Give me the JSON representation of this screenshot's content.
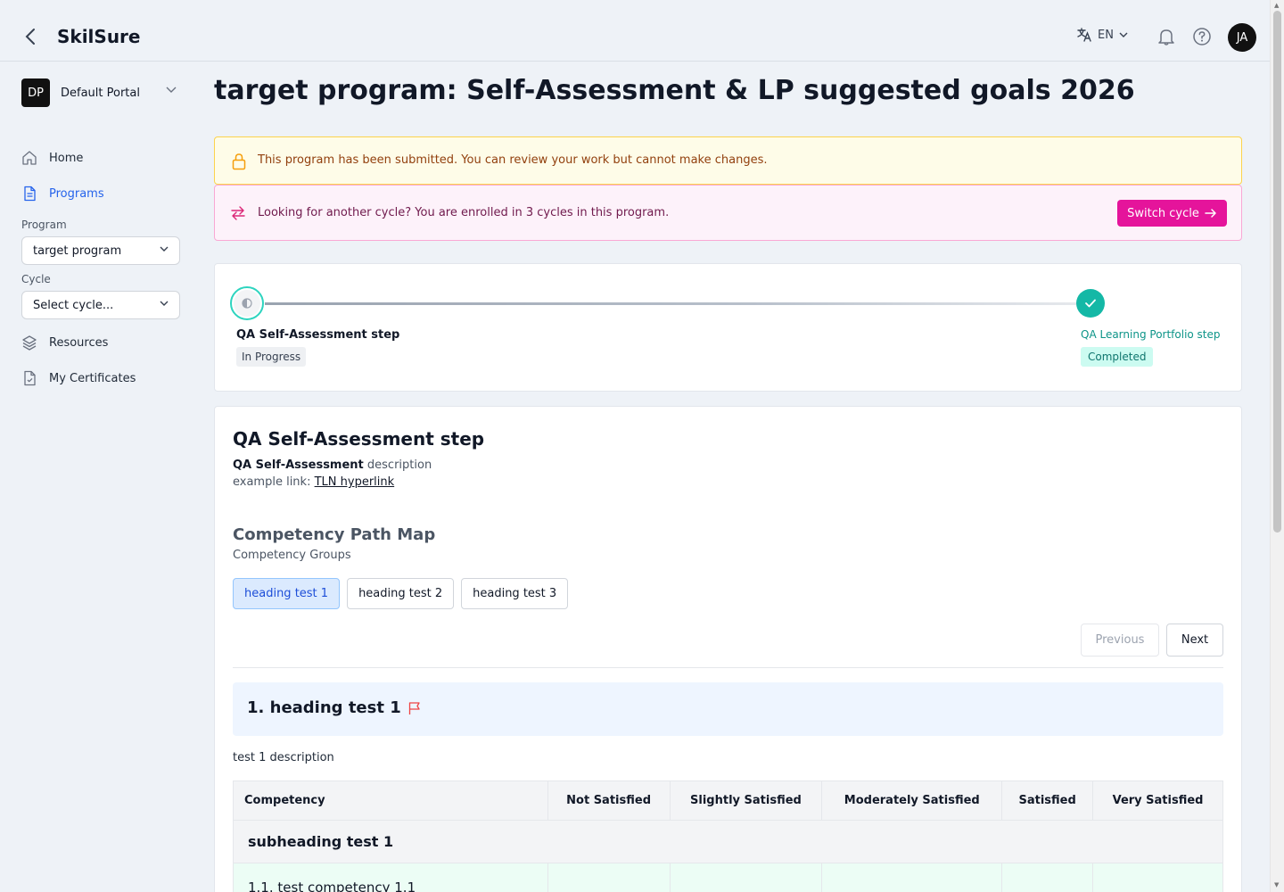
{
  "header": {
    "brand": "SkilSure",
    "language": "EN",
    "avatar_initials": "JA"
  },
  "sidebar": {
    "portal_badge": "DP",
    "portal_name": "Default Portal",
    "nav": {
      "home": "Home",
      "programs": "Programs",
      "resources": "Resources",
      "certificates": "My Certificates"
    },
    "program_label": "Program",
    "program_value": "target program",
    "cycle_label": "Cycle",
    "cycle_value": "Select cycle..."
  },
  "page": {
    "title": "target program: Self-Assessment & LP suggested goals 2026",
    "submitted_notice": "This program has been submitted. You can review your work but cannot make changes.",
    "cycle_notice": "Looking for another cycle? You are enrolled in 3 cycles in this program.",
    "switch_cycle": "Switch cycle"
  },
  "stepper": {
    "steps": [
      {
        "label": "QA Self-Assessment step",
        "status": "In Progress"
      },
      {
        "label": "QA Learning Portfolio step",
        "status": "Completed"
      }
    ]
  },
  "step_detail": {
    "title": "QA Self-Assessment step",
    "desc_bold": "QA Self-Assessment",
    "desc_rest": " description",
    "link_prefix": "example link: ",
    "link_text": "TLN hyperlink",
    "map_title": "Competency Path Map",
    "map_subtitle": "Competency Groups",
    "tabs": [
      "heading test 1",
      "heading test 2",
      "heading test 3"
    ],
    "previous": "Previous",
    "next": "Next",
    "group_title": "1. heading test 1",
    "group_desc": "test 1 description",
    "table": {
      "headers": [
        "Competency",
        "Not Satisfied",
        "Slightly Satisfied",
        "Moderately Satisfied",
        "Satisfied",
        "Very Satisfied"
      ],
      "subheading": "subheading test 1",
      "first_row": "1.1. test competency 1.1"
    }
  },
  "colors": {
    "accent_blue": "#2563eb",
    "switch_pink": "#e5149b",
    "teal": "#14b8a6"
  }
}
